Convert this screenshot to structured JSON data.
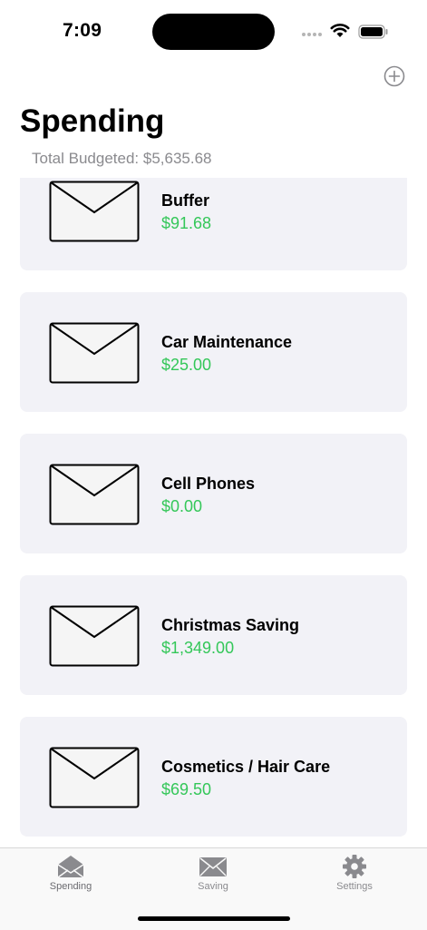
{
  "status_bar": {
    "time": "7:09"
  },
  "header": {
    "title": "Spending",
    "total_label": "Total Budgeted: $5,635.68"
  },
  "envelopes": [
    {
      "name": "Buffer",
      "amount": "$91.68"
    },
    {
      "name": "Car Maintenance",
      "amount": "$25.00"
    },
    {
      "name": "Cell Phones",
      "amount": "$0.00"
    },
    {
      "name": "Christmas Saving",
      "amount": "$1,349.00"
    },
    {
      "name": "Cosmetics / Hair Care",
      "amount": "$69.50"
    }
  ],
  "tab_bar": {
    "tabs": [
      {
        "label": "Spending",
        "icon": "open-envelope-icon",
        "active": true
      },
      {
        "label": "Saving",
        "icon": "envelope-icon",
        "active": false
      },
      {
        "label": "Settings",
        "icon": "gear-icon",
        "active": false
      }
    ]
  },
  "colors": {
    "amount": "#34c759",
    "card_background": "#f2f2f7",
    "secondary_text": "#8a8a8e"
  }
}
